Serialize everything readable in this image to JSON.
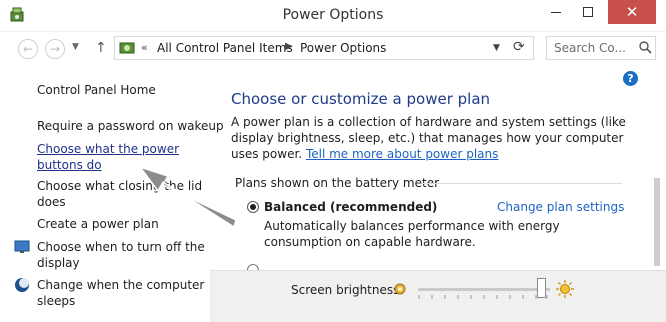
{
  "window": {
    "title": "Power Options",
    "close_label": "✕"
  },
  "address": {
    "crumbs": [
      "All Control Panel Items",
      "Power Options"
    ],
    "search_placeholder": "Search Co..."
  },
  "sidebar": {
    "home": "Control Panel Home",
    "items": [
      {
        "label": "Require a password on wakeup"
      },
      {
        "label_line1": "Choose what the power",
        "label_line2": "buttons do"
      },
      {
        "label_line1": "Choose what closing the lid",
        "label_line2": "does"
      },
      {
        "label": "Create a power plan"
      },
      {
        "label_line1": "Choose when to turn off the",
        "label_line2": "display"
      },
      {
        "label_line1": "Change when the computer",
        "label_line2": "sleeps"
      }
    ]
  },
  "main": {
    "heading": "Choose or customize a power plan",
    "intro": "A power plan is a collection of hardware and system settings (like display brightness, sleep, etc.) that manages how your computer uses power.",
    "intro_link": "Tell me more about power plans",
    "plans_label": "Plans shown on the battery meter",
    "plan": {
      "name": "Balanced (recommended)",
      "settings_link": "Change plan settings",
      "description": "Automatically balances performance with energy consumption on capable hardware."
    }
  },
  "bottom": {
    "brightness_label": "Screen brightness:",
    "brightness_level": 0.95
  },
  "colors": {
    "link": "#1b64c4",
    "heading": "#1e3b8a",
    "close": "#c7514a",
    "help": "#1a6fc0",
    "arrow": "#8c8c8c"
  }
}
